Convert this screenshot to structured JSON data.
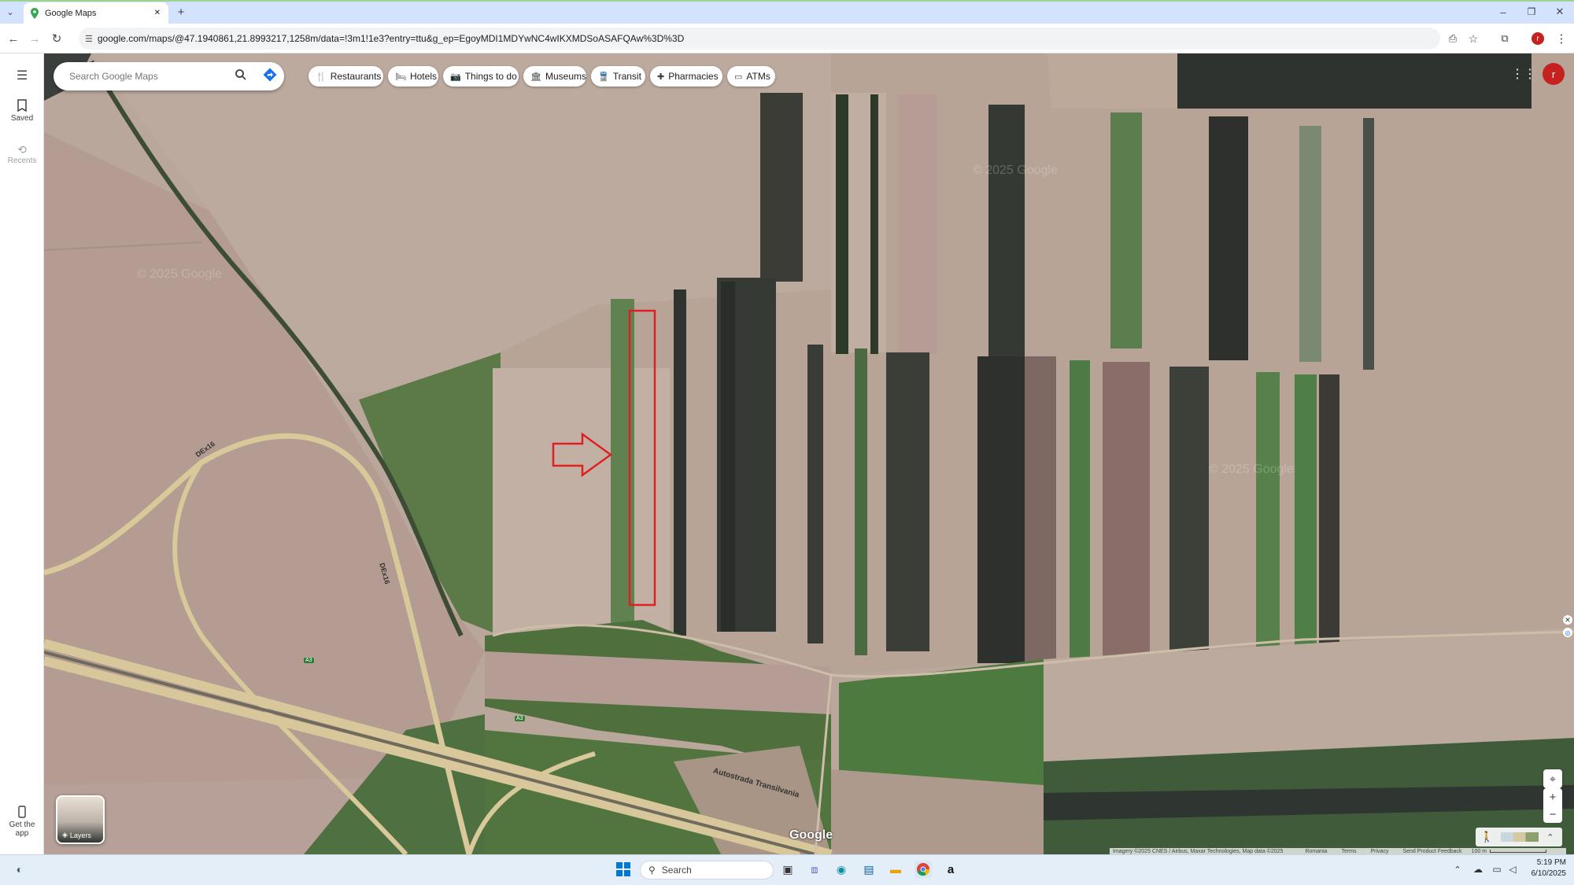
{
  "browser": {
    "tab_title": "Google Maps",
    "url": "google.com/maps/@47.1940861,21.8993217,1258m/data=!3m1!1e3?entry=ttu&g_ep=EgoyMDI1MDYwNC4wIKXMDSoASAFQAw%3D%3D",
    "new_tab_symbol": "+",
    "close_tab_symbol": "✕",
    "profile_initial": "r"
  },
  "rail": {
    "saved_label": "Saved",
    "recents_label": "Recents",
    "get_app_label": "Get the app"
  },
  "search": {
    "placeholder": "Search Google Maps"
  },
  "chips": [
    {
      "label": "Restaurants",
      "icon": "fork-knife-icon"
    },
    {
      "label": "Hotels",
      "icon": "bed-icon"
    },
    {
      "label": "Things to do",
      "icon": "camera-icon"
    },
    {
      "label": "Museums",
      "icon": "museum-icon"
    },
    {
      "label": "Transit",
      "icon": "train-icon"
    },
    {
      "label": "Pharmacies",
      "icon": "pharmacy-icon"
    },
    {
      "label": "ATMs",
      "icon": "atm-icon"
    }
  ],
  "account": {
    "initial": "r",
    "color": "#c5221f"
  },
  "map_labels": {
    "road_dex16_a": "DEx16",
    "road_dex16_b": "DEx16",
    "a3_a": "A3",
    "a3_b": "A3",
    "autostrada": "Autostrada Transilvania",
    "google_logo": "Google",
    "watermark": "© 2025 Google"
  },
  "layers": {
    "label": "Layers"
  },
  "attribution": {
    "imagery": "Imagery ©2025 CNES / Airbus, Maxar Technologies, Map data ©2025",
    "country": "Romania",
    "terms": "Terms",
    "privacy": "Privacy",
    "feedback": "Send Product Feedback",
    "scale": "100 m"
  },
  "taskbar": {
    "search_placeholder": "Search",
    "time": "5:19 PM",
    "date": "6/10/2025"
  },
  "colors": {
    "highlight": "#e02020",
    "accent": "#1a73e8"
  }
}
